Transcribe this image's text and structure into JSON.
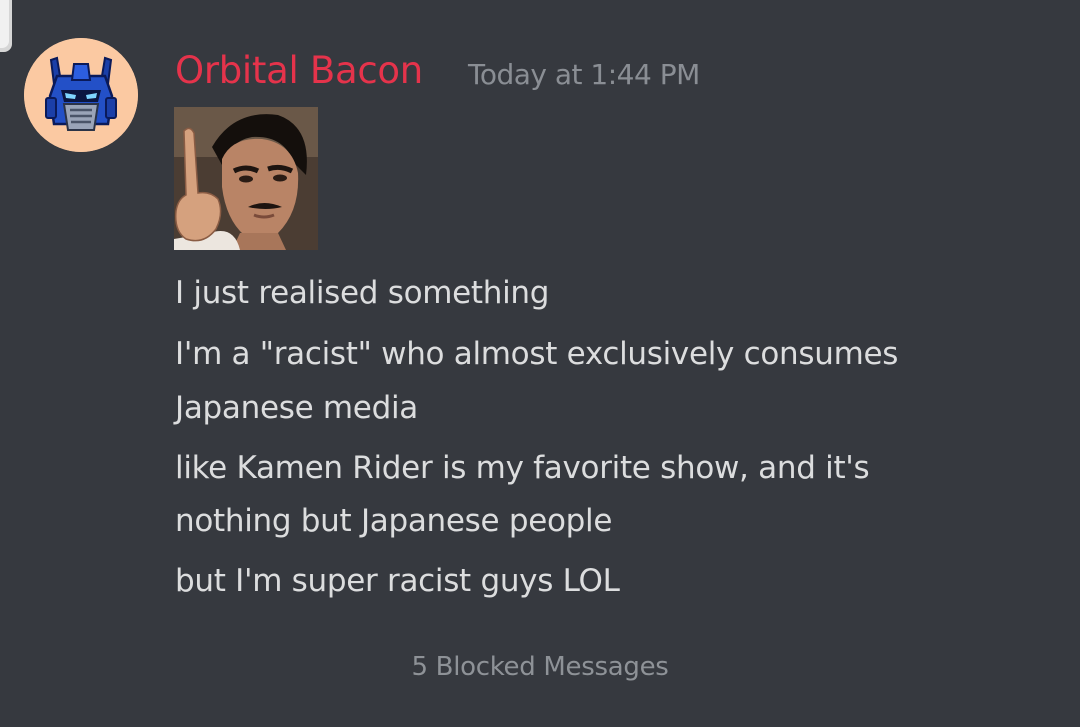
{
  "message": {
    "author": "Orbital Bacon",
    "timestamp": "Today at 1:44 PM",
    "author_color": "#e5334b",
    "lines": [
      "I just realised something",
      "I'm a \"racist\" who almost exclusively consumes",
      "Japanese media",
      "like Kamen Rider is my favorite show, and it's",
      "nothing but Japanese people",
      "but I'm super racist guys  LOL"
    ]
  },
  "footer": {
    "blocked_label": "5 Blocked Messages"
  },
  "colors": {
    "background": "#36393f",
    "text": "#dcddde",
    "muted": "#8e9297"
  }
}
